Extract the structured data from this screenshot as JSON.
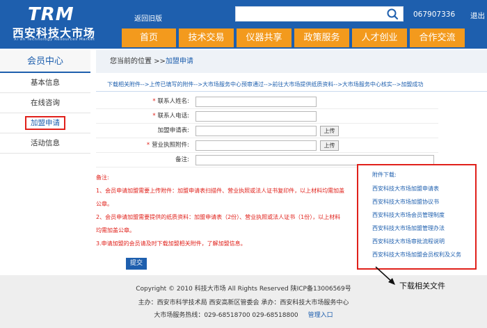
{
  "header": {
    "logo_mark": "TRM",
    "logo_name": "西安科技大市场",
    "logo_sub": "Xi'an Technology Resources Market",
    "old_version_link": "返回旧版",
    "search_placeholder": "",
    "hotline": "067907336",
    "exit_link": "退出"
  },
  "nav": {
    "items": [
      "首页",
      "技术交易",
      "仪器共享",
      "政策服务",
      "人才创业",
      "合作交流"
    ]
  },
  "sidebar": {
    "title": "会员中心",
    "items": [
      {
        "label": "基本信息"
      },
      {
        "label": "在线咨询"
      },
      {
        "label": "加盟申请"
      },
      {
        "label": "活动信息"
      }
    ]
  },
  "breadcrumb": {
    "prefix": "您当前的位置 >>",
    "current": "加盟申请"
  },
  "steps": "下载相关附件-->上传已填写的附件-->大市场服务中心预审通过-->前往大市场提供纸质资料-->大市场服务中心核实-->加盟成功",
  "form": {
    "fields": [
      {
        "label": "联系人姓名:",
        "required": "*",
        "value": ""
      },
      {
        "label": "联系人电话:",
        "required": "*",
        "value": ""
      },
      {
        "label": "加盟申请表:",
        "required": "",
        "value": ""
      },
      {
        "label": "营业执照附件:",
        "required": "*",
        "value": ""
      },
      {
        "label": "备注:",
        "required": "",
        "value": ""
      }
    ],
    "upload_label": "上传",
    "submit_label": "提交"
  },
  "notes": {
    "title": "备注:",
    "lines": [
      "1、会员申请加盟需要上传附件：加盟申请表扫描件、营业执照或法人证书复印件，以上材料均需加盖",
      "公章。",
      "2、会员申请加盟需要提供的纸质资料：加盟申请表（2份）、营业执照或法人证书（1份），以上材料",
      "均需加盖公章。",
      "3.申请加盟的会员请及时下载加盟相关附件，了解加盟信息。"
    ]
  },
  "attachments": {
    "title": "附件下载:",
    "links": [
      "西安科技大市场加盟申请表",
      "西安科技大市场加盟协议书",
      "西安科技大市场会员管理制度",
      "西安科技大市场加盟管理办法",
      "西安科技大市场审批流程说明",
      "西安科技大市场加盟会员权利及义务"
    ]
  },
  "callout": "下载相关文件",
  "footer": {
    "copyright": "Copyright © 2010 科技大市场 All Rights Reserved 陕ICP备13006569号",
    "sponsor": "主办：西安市科学技术局  西安高新区管委会  承办：西安科技大市场服务中心",
    "phone": "大市场服务热线：029-68518700  029-68518800",
    "admin_link": "管理入口"
  },
  "colors": {
    "brand_blue": "#1e5fae",
    "nav_orange": "#f39a1d",
    "highlight_red": "#e0201a"
  }
}
